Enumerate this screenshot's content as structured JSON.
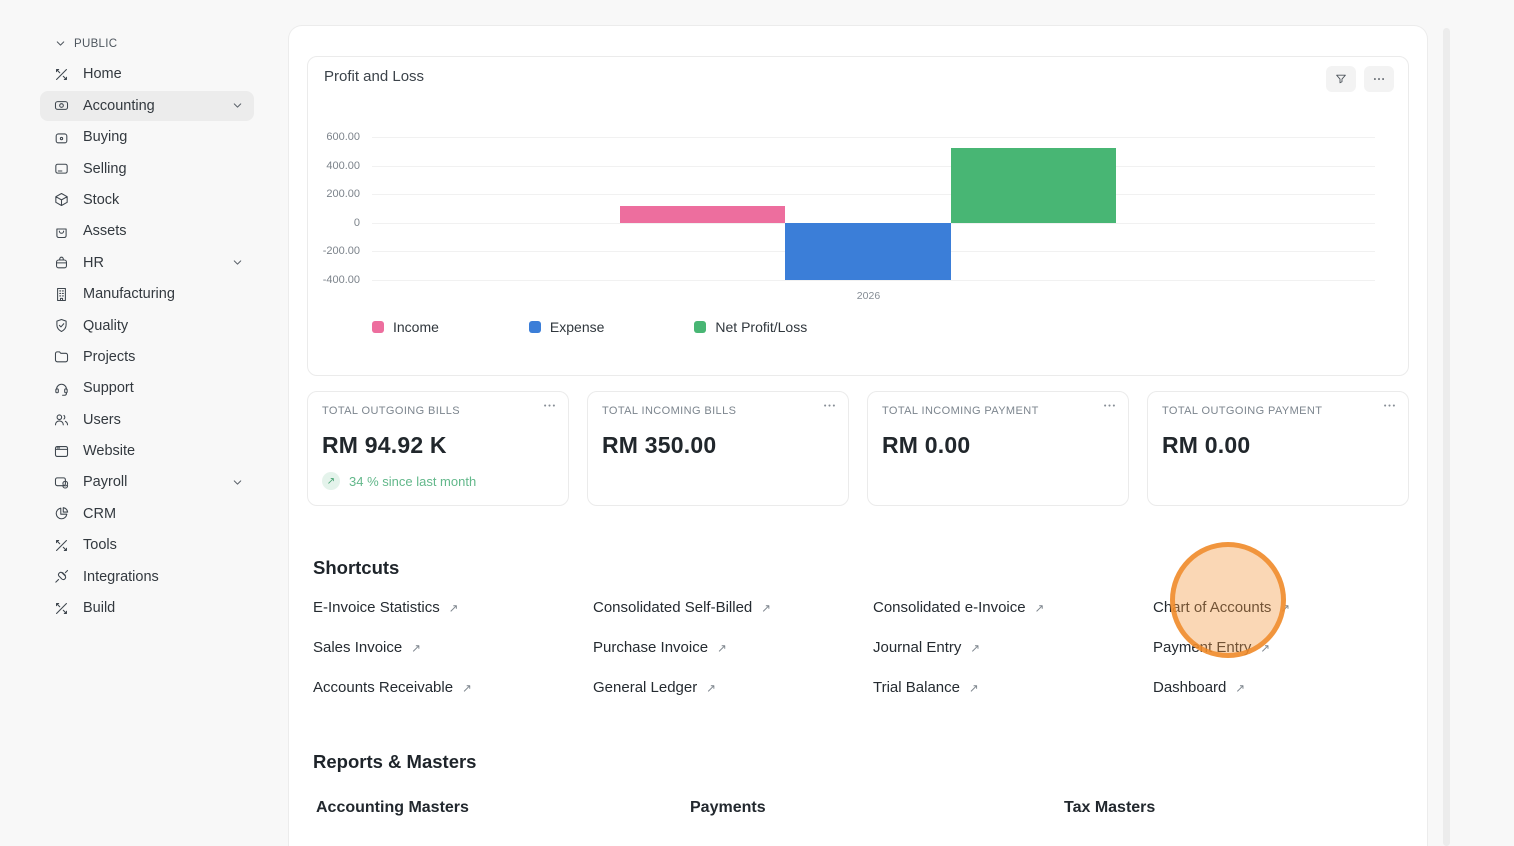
{
  "sidebar": {
    "section_label": "PUBLIC",
    "items": [
      {
        "label": "Home",
        "icon": "home-icon",
        "active": false,
        "expandable": false
      },
      {
        "label": "Accounting",
        "icon": "accounting-icon",
        "active": true,
        "expandable": true
      },
      {
        "label": "Buying",
        "icon": "buying-icon",
        "active": false,
        "expandable": false
      },
      {
        "label": "Selling",
        "icon": "selling-icon",
        "active": false,
        "expandable": false
      },
      {
        "label": "Stock",
        "icon": "stock-icon",
        "active": false,
        "expandable": false
      },
      {
        "label": "Assets",
        "icon": "assets-icon",
        "active": false,
        "expandable": false
      },
      {
        "label": "HR",
        "icon": "hr-icon",
        "active": false,
        "expandable": true
      },
      {
        "label": "Manufacturing",
        "icon": "manufacturing-icon",
        "active": false,
        "expandable": false
      },
      {
        "label": "Quality",
        "icon": "quality-icon",
        "active": false,
        "expandable": false
      },
      {
        "label": "Projects",
        "icon": "projects-icon",
        "active": false,
        "expandable": false
      },
      {
        "label": "Support",
        "icon": "support-icon",
        "active": false,
        "expandable": false
      },
      {
        "label": "Users",
        "icon": "users-icon",
        "active": false,
        "expandable": false
      },
      {
        "label": "Website",
        "icon": "website-icon",
        "active": false,
        "expandable": false
      },
      {
        "label": "Payroll",
        "icon": "payroll-icon",
        "active": false,
        "expandable": true
      },
      {
        "label": "CRM",
        "icon": "crm-icon",
        "active": false,
        "expandable": false
      },
      {
        "label": "Tools",
        "icon": "tools-icon",
        "active": false,
        "expandable": false
      },
      {
        "label": "Integrations",
        "icon": "integrations-icon",
        "active": false,
        "expandable": false
      },
      {
        "label": "Build",
        "icon": "build-icon",
        "active": false,
        "expandable": false
      }
    ]
  },
  "chart_card": {
    "title": "Profit and Loss",
    "toolbar_icons": [
      "filter-icon",
      "ellipsis-icon"
    ]
  },
  "chart_data": {
    "type": "bar",
    "title": "Profit and Loss",
    "x": [
      "2026"
    ],
    "series": [
      {
        "name": "Income",
        "color": "#ED6E9E",
        "values": [
          120
        ]
      },
      {
        "name": "Expense",
        "color": "#3B7ED8",
        "values": [
          -400
        ]
      },
      {
        "name": "Net Profit/Loss",
        "color": "#48B674",
        "values": [
          520
        ]
      }
    ],
    "yticks": [
      "600.00",
      "400.00",
      "200.00",
      "0",
      "-200.00",
      "-400.00"
    ],
    "ytick_values": [
      600,
      400,
      200,
      0,
      -200,
      -400
    ],
    "ylim": [
      -400,
      600
    ],
    "grid": true,
    "legend_position": "bottom",
    "xlabel": "",
    "ylabel": ""
  },
  "stat_cards": [
    {
      "label": "TOTAL OUTGOING BILLS",
      "value": "RM 94.92 K",
      "trend": "34 % since last month",
      "trend_direction": "up",
      "menu_icon": "ellipsis-icon"
    },
    {
      "label": "TOTAL INCOMING BILLS",
      "value": "RM 350.00",
      "trend": null,
      "menu_icon": "ellipsis-icon"
    },
    {
      "label": "TOTAL INCOMING PAYMENT",
      "value": "RM 0.00",
      "trend": null,
      "menu_icon": "ellipsis-icon"
    },
    {
      "label": "TOTAL OUTGOING PAYMENT",
      "value": "RM 0.00",
      "trend": null,
      "menu_icon": "ellipsis-icon"
    }
  ],
  "shortcuts": {
    "title": "Shortcuts",
    "items": [
      "E-Invoice Statistics",
      "Consolidated Self-Billed",
      "Consolidated e-Invoice",
      "Chart of Accounts",
      "Sales Invoice",
      "Purchase Invoice",
      "Journal Entry",
      "Payment Entry",
      "Accounts Receivable",
      "General Ledger",
      "Trial Balance",
      "Dashboard"
    ],
    "link_arrow": "↗"
  },
  "reports": {
    "title": "Reports & Masters",
    "groups": [
      "Accounting Masters",
      "Payments",
      "Tax Masters"
    ]
  },
  "highlight": {
    "target": "Chart of Accounts",
    "color": "#EE8928"
  },
  "colors": {
    "income_pink": "#ED6E9E",
    "expense_blue": "#3B7ED8",
    "net_green": "#48B674",
    "trend_green": "#63B88B",
    "active_item_bg": "#ECECEC"
  },
  "trend_arrow": "↗"
}
